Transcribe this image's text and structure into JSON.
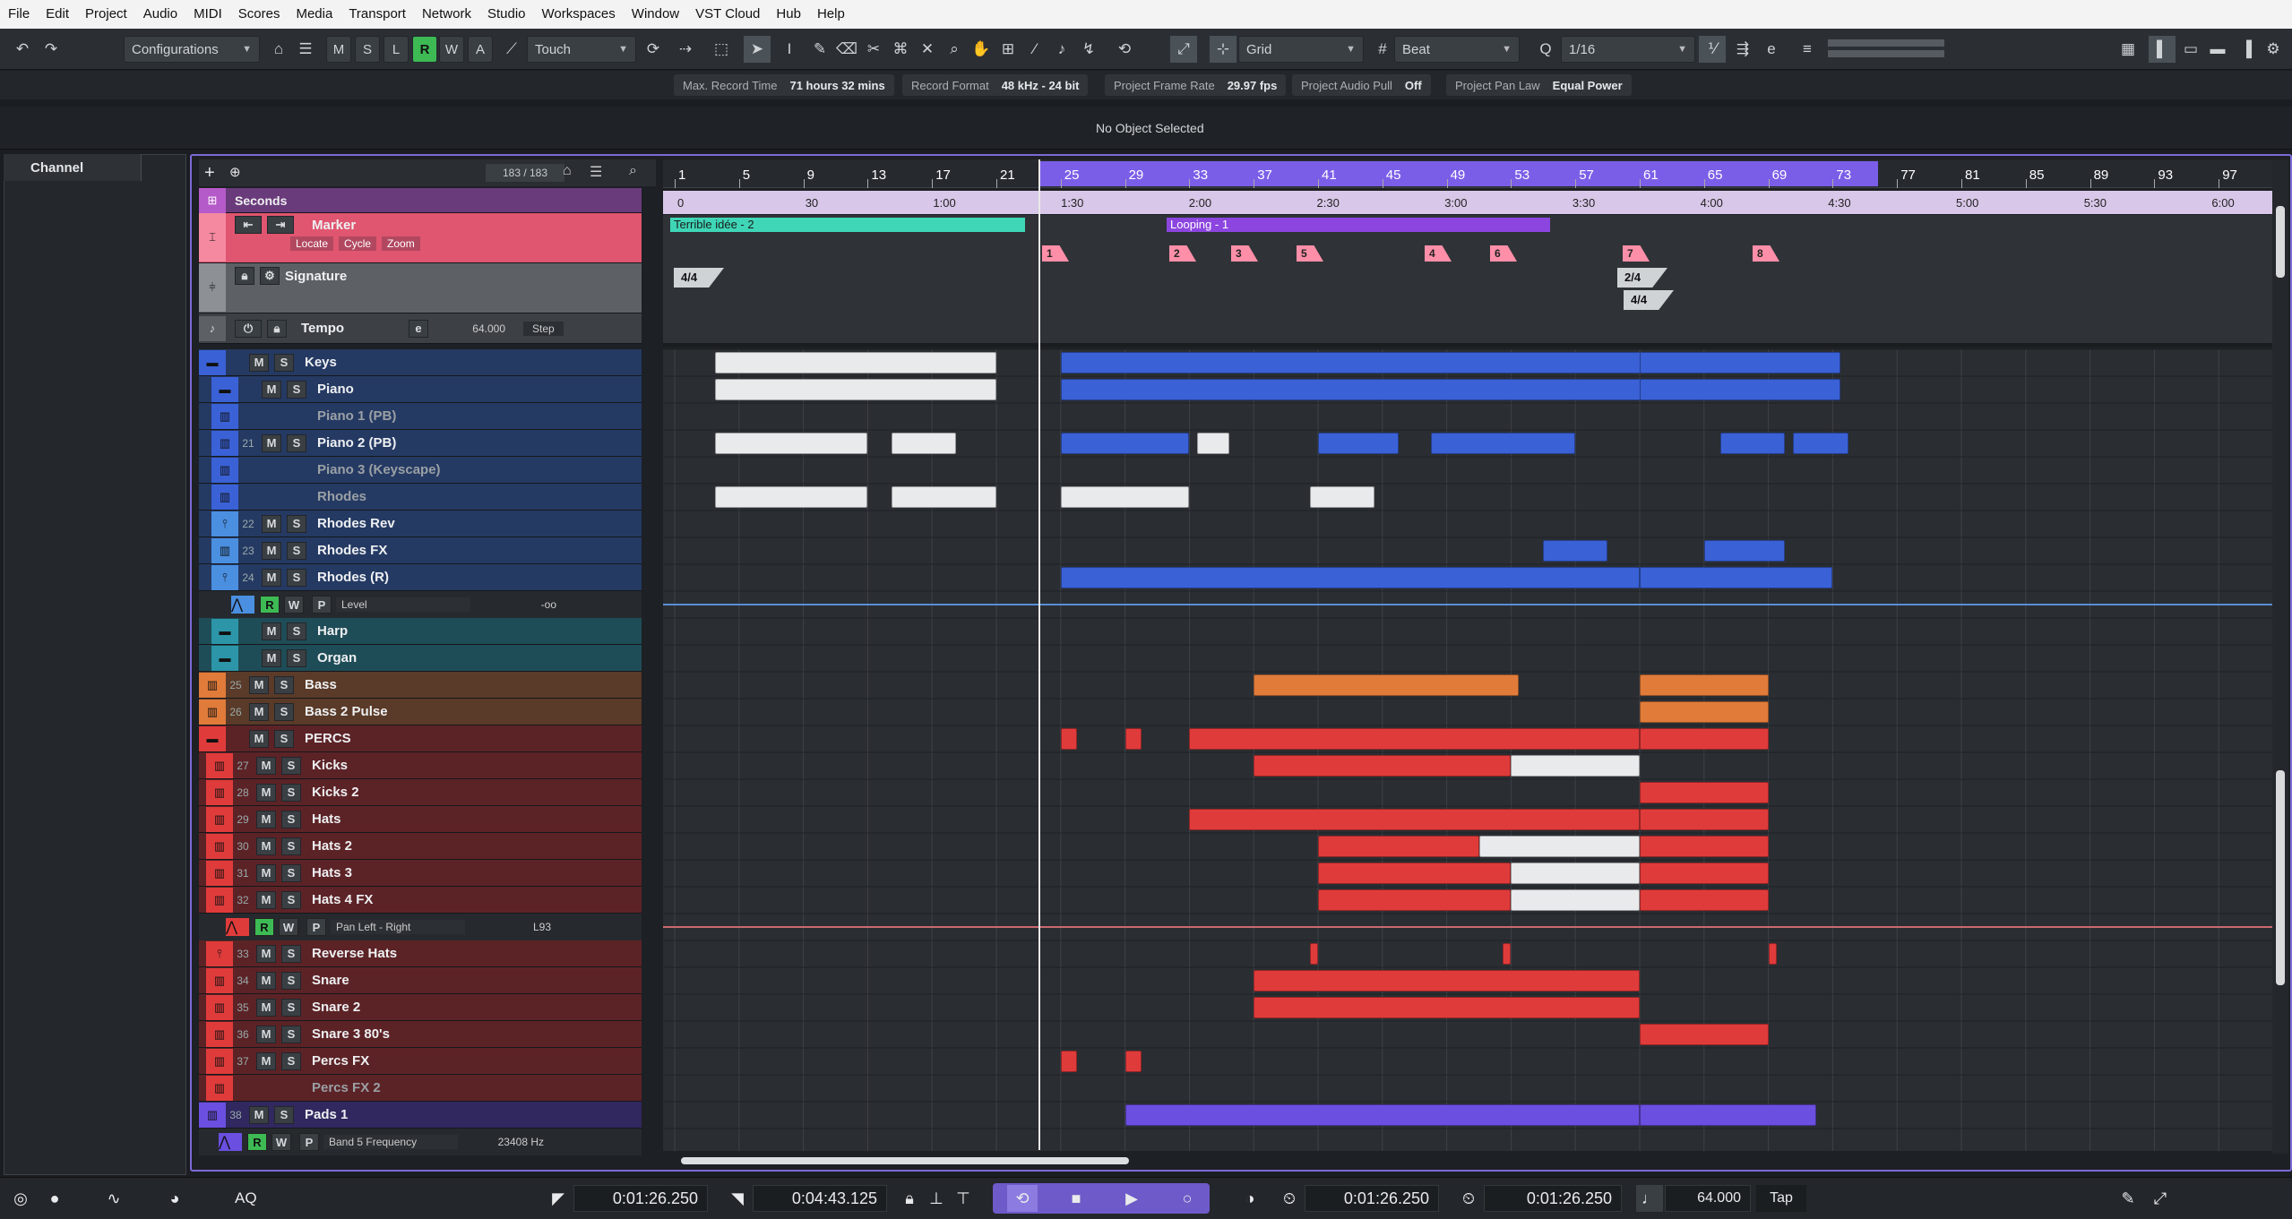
{
  "menu": [
    "File",
    "Edit",
    "Project",
    "Audio",
    "MIDI",
    "Scores",
    "Media",
    "Transport",
    "Network",
    "Studio",
    "Workspaces",
    "Window",
    "VST Cloud",
    "Hub",
    "Help"
  ],
  "toolbar": {
    "configurations": "Configurations",
    "msl": [
      "M",
      "S",
      "L"
    ],
    "rwa": [
      "R",
      "W",
      "A"
    ],
    "automation_mode": "Touch",
    "grid": "Grid",
    "grid_type": "Beat",
    "quantize": "1/16"
  },
  "info_line": [
    {
      "label": "Max. Record Time",
      "value": "71 hours 32 mins"
    },
    {
      "label": "Record Format",
      "value": "48 kHz - 24 bit"
    },
    {
      "label": "Project Frame Rate",
      "value": "29.97 fps"
    },
    {
      "label": "Project Audio Pull",
      "value": "Off"
    },
    {
      "label": "Project Pan Law",
      "value": "Equal Power"
    }
  ],
  "object_selection": "No Object Selected",
  "channel_tab": "Channel",
  "track_count": "183 / 183",
  "ruler_track": {
    "label": "Seconds"
  },
  "marker_track": {
    "name": "Marker",
    "locate": "Locate",
    "cycle": "Cycle",
    "zoom": "Zoom"
  },
  "signature_track": {
    "name": "Signature"
  },
  "tempo_track": {
    "name": "Tempo",
    "value": "64.000",
    "mode": "Step"
  },
  "bars": [
    "1",
    "5",
    "9",
    "13",
    "17",
    "21",
    "25",
    "29",
    "33",
    "37",
    "41",
    "45",
    "49",
    "53",
    "57",
    "61",
    "65",
    "69",
    "73",
    "77",
    "81",
    "85",
    "89",
    "93",
    "97"
  ],
  "times": [
    "0",
    "30",
    "1:00",
    "1:30",
    "2:00",
    "2:30",
    "3:00",
    "3:30",
    "4:00",
    "4:30",
    "5:00",
    "5:30",
    "6:00"
  ],
  "cycle_markers": [
    {
      "label": "Terrible idée -  2",
      "color": "#3fd6b7"
    },
    {
      "label": "Looping -  1",
      "color": "#8c46df"
    }
  ],
  "position_markers": [
    "1",
    "2",
    "3",
    "5",
    "4",
    "6",
    "7",
    "8"
  ],
  "signatures": [
    "4/4",
    "2/4",
    "4/4"
  ],
  "tracks": [
    {
      "name": "Keys",
      "num": "",
      "kind": "folder",
      "color": "#3a61d6"
    },
    {
      "name": "Piano",
      "num": "",
      "kind": "folder",
      "color": "#3a61d6"
    },
    {
      "name": "Piano 1 (PB)",
      "num": "",
      "kind": "inst-dim",
      "color": "#3a61d6"
    },
    {
      "name": "Piano 2 (PB)",
      "num": "21",
      "kind": "inst",
      "color": "#3a61d6"
    },
    {
      "name": "Piano 3 (Keyscape)",
      "num": "",
      "kind": "inst-dim",
      "color": "#3a61d6"
    },
    {
      "name": "Rhodes",
      "num": "",
      "kind": "inst-dim",
      "color": "#3a61d6"
    },
    {
      "name": "Rhodes Rev",
      "num": "22",
      "kind": "audio",
      "color": "#4a8fe0"
    },
    {
      "name": "Rhodes FX",
      "num": "23",
      "kind": "inst",
      "color": "#4a8fe0"
    },
    {
      "name": "Rhodes (R)",
      "num": "24",
      "kind": "audio",
      "color": "#4a8fe0"
    },
    {
      "name": "Level",
      "num": "",
      "kind": "auto",
      "color": "#4a8fe0",
      "value": "-oo"
    },
    {
      "name": "Harp",
      "num": "",
      "kind": "folder",
      "color": "#2c95a8"
    },
    {
      "name": "Organ",
      "num": "",
      "kind": "folder",
      "color": "#2c95a8"
    },
    {
      "name": "Bass",
      "num": "25",
      "kind": "inst",
      "color": "#e07b3a"
    },
    {
      "name": "Bass 2 Pulse",
      "num": "26",
      "kind": "inst",
      "color": "#e07b3a"
    },
    {
      "name": "PERCS",
      "num": "",
      "kind": "folder",
      "color": "#e03b3b"
    },
    {
      "name": "Kicks",
      "num": "27",
      "kind": "inst",
      "color": "#e03b3b"
    },
    {
      "name": "Kicks 2",
      "num": "28",
      "kind": "inst",
      "color": "#e03b3b"
    },
    {
      "name": "Hats",
      "num": "29",
      "kind": "inst",
      "color": "#e03b3b"
    },
    {
      "name": "Hats 2",
      "num": "30",
      "kind": "inst",
      "color": "#e03b3b"
    },
    {
      "name": "Hats 3",
      "num": "31",
      "kind": "inst",
      "color": "#e03b3b"
    },
    {
      "name": "Hats 4 FX",
      "num": "32",
      "kind": "inst",
      "color": "#e03b3b"
    },
    {
      "name": "Pan Left - Right",
      "num": "",
      "kind": "auto",
      "color": "#e03b3b",
      "value": "L93"
    },
    {
      "name": "Reverse Hats",
      "num": "33",
      "kind": "audio",
      "color": "#e03b3b"
    },
    {
      "name": "Snare",
      "num": "34",
      "kind": "inst",
      "color": "#e03b3b"
    },
    {
      "name": "Snare 2",
      "num": "35",
      "kind": "inst",
      "color": "#e03b3b"
    },
    {
      "name": "Snare 3 80's",
      "num": "36",
      "kind": "inst",
      "color": "#e03b3b"
    },
    {
      "name": "Percs FX",
      "num": "37",
      "kind": "inst",
      "color": "#e03b3b"
    },
    {
      "name": "Percs FX 2",
      "num": "",
      "kind": "inst-dim",
      "color": "#e03b3b"
    },
    {
      "name": "Pads 1",
      "num": "38",
      "kind": "inst",
      "color": "#6a4fe0"
    },
    {
      "name": "Band 5 Frequency",
      "num": "",
      "kind": "auto",
      "color": "#6a4fe0",
      "value": "23408 Hz"
    }
  ],
  "transport": {
    "left_locator": "0:01:26.250",
    "right_locator": "0:04:43.125",
    "primary_time": "0:01:26.250",
    "secondary_time": "0:01:26.250",
    "tempo": "64.000",
    "tap": "Tap",
    "aq": "AQ"
  }
}
